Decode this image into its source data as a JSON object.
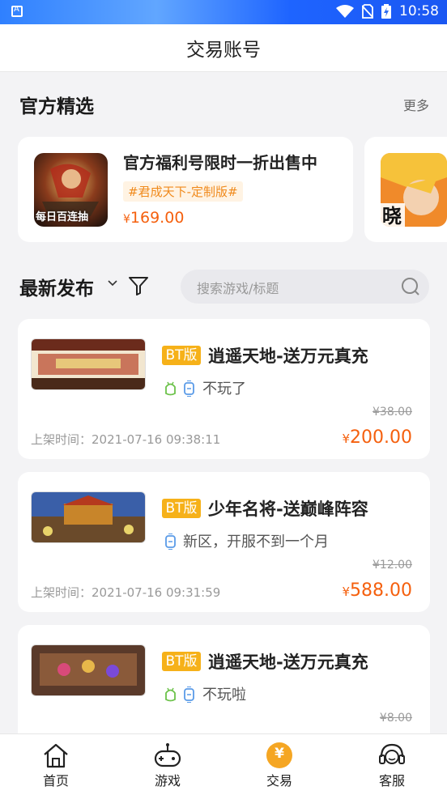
{
  "status_bar": {
    "time": "10:58"
  },
  "header": {
    "title": "交易账号"
  },
  "official": {
    "title": "官方精选",
    "more": "更多",
    "cards": [
      {
        "title": "官方福利号限时一折出售中",
        "tag": "#君成天下-定制版#",
        "price_symbol": "¥",
        "price": "169.00",
        "img_text": "每日百连抽"
      },
      {
        "img_text": "晓"
      }
    ]
  },
  "latest": {
    "title": "最新发布",
    "search_placeholder": "搜索游戏/标题",
    "items": [
      {
        "badge": "BT版",
        "title": "逍遥天地-送万元真充",
        "desc": "不玩了",
        "platforms": [
          "android",
          "ios"
        ],
        "original_price": "¥38.00",
        "time_label": "上架时间：",
        "time": "2021-07-16 09:38:11",
        "price_symbol": "¥",
        "price": "200.00"
      },
      {
        "badge": "BT版",
        "title": "少年名将-送巅峰阵容",
        "desc": "新区，开服不到一个月",
        "platforms": [
          "ios"
        ],
        "original_price": "¥12.00",
        "time_label": "上架时间：",
        "time": "2021-07-16 09:31:59",
        "price_symbol": "¥",
        "price": "588.00"
      },
      {
        "badge": "BT版",
        "title": "逍遥天地-送万元真充",
        "desc": "不玩啦",
        "platforms": [
          "android",
          "ios"
        ],
        "original_price": "¥8.00"
      }
    ]
  },
  "bottom_nav": {
    "items": [
      {
        "label": "首页",
        "icon": "home-icon"
      },
      {
        "label": "游戏",
        "icon": "gamepad-icon"
      },
      {
        "label": "交易",
        "icon": "yen-coin-icon",
        "active": true,
        "active_glyph": "¥"
      },
      {
        "label": "客服",
        "icon": "headset-icon"
      }
    ]
  },
  "colors": {
    "accent": "#f5600e",
    "badge": "#f6b119",
    "tag_bg": "#fff3e3",
    "tag_text": "#f08a1c",
    "active_nav": "#f5a623"
  }
}
